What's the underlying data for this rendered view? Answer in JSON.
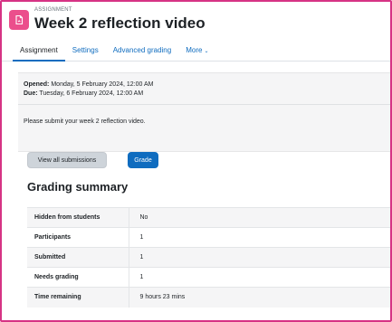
{
  "header": {
    "overline": "ASSIGNMENT",
    "title": "Week 2 reflection video",
    "icon": "assignment-icon",
    "icon_color": "#eb4f8c"
  },
  "tabs": [
    {
      "label": "Assignment",
      "active": true
    },
    {
      "label": "Settings",
      "active": false
    },
    {
      "label": "Advanced grading",
      "active": false
    },
    {
      "label": "More",
      "active": false
    }
  ],
  "dates": {
    "opened_label": "Opened:",
    "opened_value": "Monday, 5 February 2024, 12:00 AM",
    "due_label": "Due:",
    "due_value": "Tuesday, 6 February 2024, 12:00 AM"
  },
  "intro": "Please submit your week 2 reflection video.",
  "actions": {
    "view_all": "View all submissions",
    "grade": "Grade"
  },
  "grading_summary": {
    "title": "Grading summary",
    "rows": [
      {
        "label": "Hidden from students",
        "value": "No"
      },
      {
        "label": "Participants",
        "value": "1"
      },
      {
        "label": "Submitted",
        "value": "1"
      },
      {
        "label": "Needs grading",
        "value": "1"
      },
      {
        "label": "Time remaining",
        "value": "9 hours 23 mins"
      }
    ]
  },
  "colors": {
    "accent": "#0f6cbf",
    "frame": "#d63384",
    "secondary_button": "#ced4da"
  }
}
